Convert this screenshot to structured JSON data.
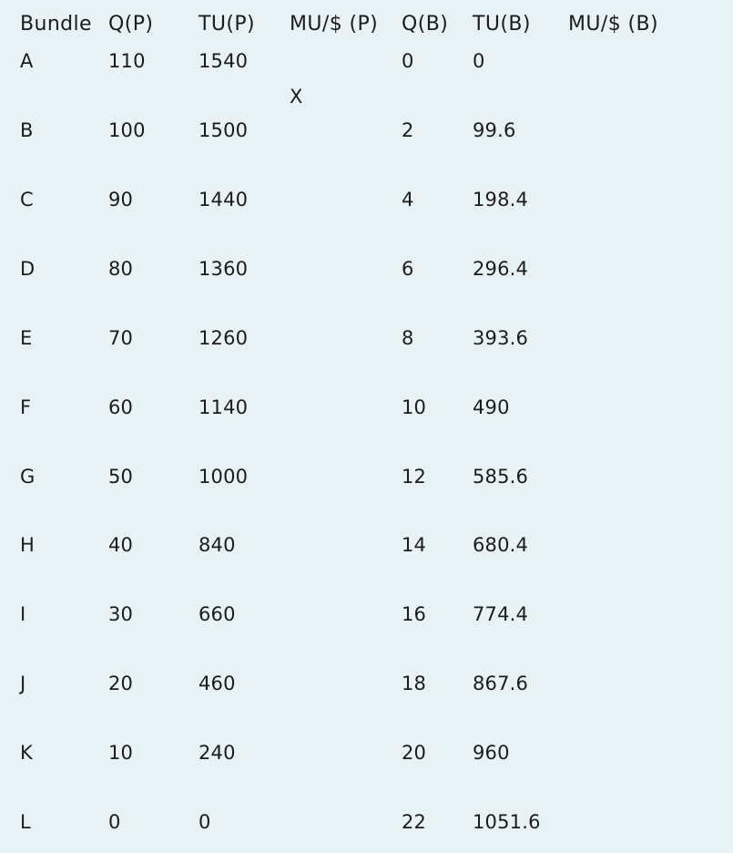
{
  "headers": {
    "bundle": "Bundle",
    "qp": "Q(P)",
    "tup": "TU(P)",
    "mup": "MU/$ (P)",
    "qb": "Q(B)",
    "tub": "TU(B)",
    "mub": "MU/$  (B)"
  },
  "marker": "X",
  "rows": [
    {
      "bundle": "A",
      "qp": "110",
      "tup": "1540",
      "qb": "0",
      "tub": "0"
    },
    {
      "bundle": "B",
      "qp": "100",
      "tup": "1500",
      "qb": "2",
      "tub": "99.6"
    },
    {
      "bundle": "C",
      "qp": "90",
      "tup": "1440",
      "qb": "4",
      "tub": "198.4"
    },
    {
      "bundle": "D",
      "qp": "80",
      "tup": "1360",
      "qb": "6",
      "tub": "296.4"
    },
    {
      "bundle": "E",
      "qp": "70",
      "tup": "1260",
      "qb": "8",
      "tub": "393.6"
    },
    {
      "bundle": "F",
      "qp": "60",
      "tup": "1140",
      "qb": "10",
      "tub": "490"
    },
    {
      "bundle": "G",
      "qp": "50",
      "tup": "1000",
      "qb": "12",
      "tub": "585.6"
    },
    {
      "bundle": "H",
      "qp": "40",
      "tup": "840",
      "qb": "14",
      "tub": "680.4"
    },
    {
      "bundle": "I",
      "qp": "30",
      "tup": "660",
      "qb": "16",
      "tub": "774.4"
    },
    {
      "bundle": "J",
      "qp": "20",
      "tup": "460",
      "qb": "18",
      "tub": "867.6"
    },
    {
      "bundle": "K",
      "qp": "10",
      "tup": "240",
      "qb": "20",
      "tub": "960"
    },
    {
      "bundle": "L",
      "qp": "0",
      "tup": "0",
      "qb": "22",
      "tub": "1051.6"
    }
  ]
}
